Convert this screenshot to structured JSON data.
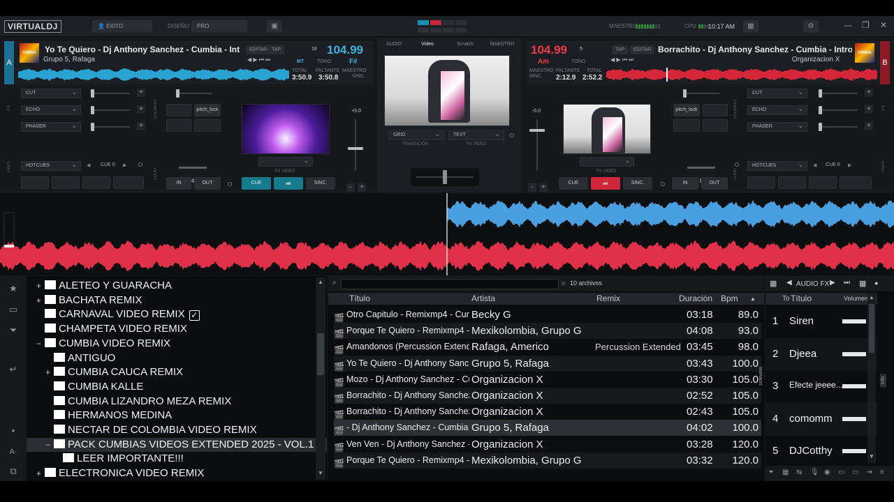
{
  "topbar": {
    "logo": "VIRTUALDJ",
    "user": "EXITO",
    "layout_label": "DISEÑO",
    "layout_value": "PRO",
    "master_label": "MAESTRO",
    "cpu_label": "CPU",
    "clock": "10:17 AM"
  },
  "deck_left": {
    "side": "A",
    "title": "Yo Te Quiero - Dj Anthony Sanchez - Cumbia - Int",
    "artist": "Grupo 5, Rafaga",
    "edit_label": "EDITAR",
    "tap_label": "TAP",
    "bpm": "104.99",
    "key": "F#",
    "key_mode": "MT",
    "tone_label": "TONO",
    "small_val": "16",
    "total_label": "TOTAL",
    "total": "3:50.9",
    "remain_label": "FALTANTE",
    "remain": "3:50.8",
    "master_label": "MAESTRO",
    "sync_label": "SINC.",
    "pitch": "+5.0"
  },
  "deck_right": {
    "side": "B",
    "title": "Borrachito - Dj Anthony Sanchez - Cumbia - Intro",
    "artist": "Organizacion X",
    "edit_label": "EDITAR",
    "tap_label": "TAP",
    "bpm": "104.99",
    "key": "Am",
    "small_val": "5",
    "tone_label": "TONO",
    "master_label": "MAESTRO",
    "sync_label": "SINC.",
    "elapsed_label": "FALTANTE",
    "elapsed": "2:12.9",
    "total_label": "TOTAL",
    "total": "2:52.2",
    "pitch": "-0.0"
  },
  "center_tabs": [
    "AUDIO",
    "Video",
    "Scratch",
    "MAESTRO"
  ],
  "center": {
    "transition_value": "GRID",
    "transition_label": "TRANSICION",
    "fx_value": "TEXT",
    "fx_label": "FX VIDEO"
  },
  "fx_left": [
    "CUT",
    "ECHO",
    "PHASER"
  ],
  "fx_right": [
    "CUT",
    "ECHO",
    "PHASER"
  ],
  "pads_label": "HOTCUES",
  "cue_small": "CUE 0",
  "user_label": "USUARIO",
  "pitch_lock": "pitch_lock",
  "loop_left": "4",
  "loop_right": "8",
  "in_label": "IN",
  "out_label": "OUT",
  "cue_label": "CUE",
  "sync_label": "SINC.",
  "fx_video_label": "FX VIDEO",
  "tree": [
    {
      "t": "+",
      "label": "ALETEO Y GUARACHA",
      "lvl": 0
    },
    {
      "t": "+",
      "label": "BACHATA REMIX",
      "lvl": 0
    },
    {
      "t": "",
      "label": "CARNAVAL VIDEO REMIX",
      "lvl": 0,
      "check": true
    },
    {
      "t": "",
      "label": "CHAMPETA VIDEO REMIX",
      "lvl": 0
    },
    {
      "t": "−",
      "label": "CUMBIA VIDEO REMIX",
      "lvl": 0
    },
    {
      "t": "",
      "label": "ANTIGUO",
      "lvl": 1
    },
    {
      "t": "+",
      "label": "CUMBIA CAUCA REMIX",
      "lvl": 1
    },
    {
      "t": "",
      "label": "CUMBIA KALLE",
      "lvl": 1
    },
    {
      "t": "",
      "label": "CUMBIA LIZANDRO MEZA REMIX",
      "lvl": 1
    },
    {
      "t": "",
      "label": "HERMANOS MEDINA",
      "lvl": 1
    },
    {
      "t": "",
      "label": "NECTAR DE COLOMBIA VIDEO REMIX",
      "lvl": 1
    },
    {
      "t": "−",
      "label": "PACK CUMBIAS VIDEOS EXTENDED 2025 - VOL.1",
      "lvl": 1,
      "sel": true
    },
    {
      "t": "",
      "label": "LEER IMPORTANTE!!!",
      "lvl": 2
    },
    {
      "t": "+",
      "label": "ELECTRONICA VIDEO REMIX",
      "lvl": 0
    }
  ],
  "file_count": "10 archivos",
  "columns": {
    "title": "Título",
    "artist": "Artista",
    "remix": "Remix",
    "duration": "Duración",
    "bpm": "Bpm"
  },
  "rows": [
    {
      "title": "Otro Capitulo - Remixmp4 - Cumb...",
      "artist": "Becky G",
      "remix": "",
      "dur": "03:18",
      "bpm": "89.0"
    },
    {
      "title": "Porque Te Quiero - Remixmp4 -...",
      "artist": "Mexikolombia, Grupo G",
      "remix": "",
      "dur": "04:08",
      "bpm": "93.0"
    },
    {
      "title": "Amandonos (Percussion Extende...",
      "artist": "Rafaga, Americo",
      "remix": "Percussion Extended",
      "dur": "03:45",
      "bpm": "98.0"
    },
    {
      "title": "Yo Te Quiero - Dj Anthony Sanch...",
      "artist": "Grupo 5, Rafaga",
      "remix": "",
      "dur": "03:43",
      "bpm": "100.0"
    },
    {
      "title": "Mozo - Dj Anthony Sanchez - Cu...",
      "artist": "Organizacion X",
      "remix": "",
      "dur": "03:30",
      "bpm": "105.0"
    },
    {
      "title": "Borrachito - Dj Anthony Sanchez...",
      "artist": "Organizacion X",
      "remix": "",
      "dur": "02:52",
      "bpm": "105.0"
    },
    {
      "title": "Borrachito - Dj Anthony Sanchez...",
      "artist": "Organizacion X",
      "remix": "",
      "dur": "02:43",
      "bpm": "105.0"
    },
    {
      "title": "- Dj Anthony Sanchez - Cumbia - Intr",
      "artist": "Grupo 5, Rafaga",
      "remix": "",
      "dur": "04:02",
      "bpm": "100.0"
    },
    {
      "title": "Ven Ven - Dj Anthony Sanchez -...",
      "artist": "Organizacion X",
      "remix": "",
      "dur": "03:28",
      "bpm": "120.0"
    },
    {
      "title": "Porque Te Quiero - Remixmp4 -...",
      "artist": "Mexikolombia, Grupo G",
      "remix": "",
      "dur": "03:32",
      "bpm": "120.0"
    }
  ],
  "sampler": {
    "bank": "AUDIO FX",
    "col_num": "To",
    "col_title": "Título",
    "col_vol": "Volumen",
    "items": [
      {
        "n": "1",
        "name": "Siren"
      },
      {
        "n": "2",
        "name": "Djeea"
      },
      {
        "n": "3",
        "name": "Efecte jeeee..."
      },
      {
        "n": "4",
        "name": "comomm"
      },
      {
        "n": "5",
        "name": "DJCotthy"
      }
    ]
  },
  "side_tabs": {
    "folders": "folders",
    "sideview": "sideview",
    "info": "info"
  },
  "colors": {
    "deck_a": "#2ba3d6",
    "deck_b": "#e0283c",
    "bpm_a": "#3fb3e0",
    "bpm_b": "#f03a4a"
  }
}
